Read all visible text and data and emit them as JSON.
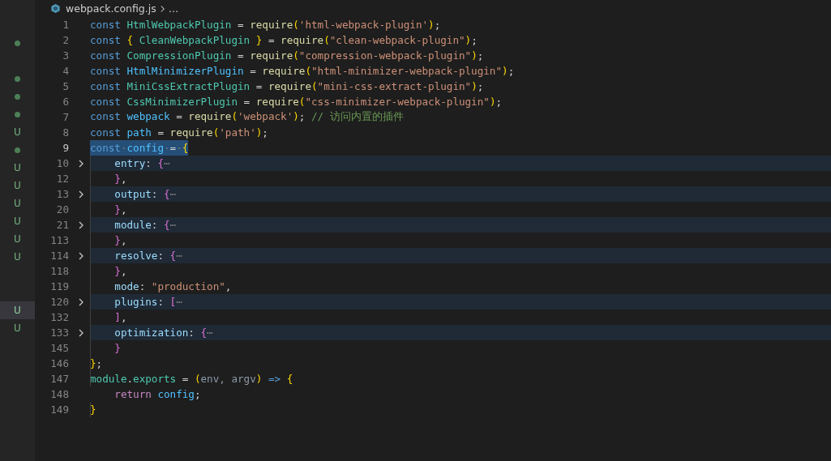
{
  "side_markers": [
    {
      "kind": "empty",
      "selected": false
    },
    {
      "kind": "dot",
      "selected": false
    },
    {
      "kind": "empty",
      "selected": false
    },
    {
      "kind": "dot",
      "selected": false
    },
    {
      "kind": "dot",
      "selected": false
    },
    {
      "kind": "dot",
      "selected": false
    },
    {
      "kind": "letter",
      "text": "U",
      "selected": false
    },
    {
      "kind": "dot",
      "selected": false
    },
    {
      "kind": "letter",
      "text": "U",
      "selected": false
    },
    {
      "kind": "letter",
      "text": "U",
      "selected": false
    },
    {
      "kind": "letter",
      "text": "U",
      "selected": false
    },
    {
      "kind": "letter",
      "text": "U",
      "selected": false
    },
    {
      "kind": "letter",
      "text": "U",
      "selected": false
    },
    {
      "kind": "letter",
      "text": "U",
      "selected": false
    },
    {
      "kind": "empty",
      "selected": false
    },
    {
      "kind": "empty",
      "selected": false
    },
    {
      "kind": "letter",
      "text": "U",
      "selected": true
    },
    {
      "kind": "letter",
      "text": "U",
      "selected": false
    }
  ],
  "breadcrumb": {
    "file": "webpack.config.js",
    "more": "…"
  },
  "lines": [
    {
      "number": "1",
      "folded": false,
      "current": false,
      "tokens": [
        {
          "t": "const ",
          "kind": "kw"
        },
        {
          "t": "HtmlWebpackPlugin",
          "kind": "cls"
        },
        {
          "t": " = ",
          "kind": "p"
        },
        {
          "t": "require",
          "kind": "fn"
        },
        {
          "t": "(",
          "kind": "b1"
        },
        {
          "t": "'html-webpack-plugin'",
          "kind": "str"
        },
        {
          "t": ")",
          "kind": "b1"
        },
        {
          "t": ";",
          "kind": "p"
        }
      ]
    },
    {
      "number": "2",
      "folded": false,
      "current": false,
      "tokens": [
        {
          "t": "const ",
          "kind": "kw"
        },
        {
          "t": "{",
          "kind": "b1"
        },
        {
          "t": " CleanWebpackPlugin ",
          "kind": "cls"
        },
        {
          "t": "}",
          "kind": "b1"
        },
        {
          "t": " = ",
          "kind": "p"
        },
        {
          "t": "require",
          "kind": "fn"
        },
        {
          "t": "(",
          "kind": "b1"
        },
        {
          "t": "\"clean-webpack-plugin\"",
          "kind": "str"
        },
        {
          "t": ")",
          "kind": "b1"
        },
        {
          "t": ";",
          "kind": "p"
        }
      ]
    },
    {
      "number": "3",
      "folded": false,
      "current": false,
      "tokens": [
        {
          "t": "const ",
          "kind": "kw"
        },
        {
          "t": "CompressionPlugin",
          "kind": "cls"
        },
        {
          "t": " = ",
          "kind": "p"
        },
        {
          "t": "require",
          "kind": "fn"
        },
        {
          "t": "(",
          "kind": "b1"
        },
        {
          "t": "\"compression-webpack-plugin\"",
          "kind": "str"
        },
        {
          "t": ")",
          "kind": "b1"
        },
        {
          "t": ";",
          "kind": "p"
        }
      ]
    },
    {
      "number": "4",
      "folded": false,
      "current": false,
      "tokens": [
        {
          "t": "const ",
          "kind": "kw"
        },
        {
          "t": "HtmlMinimizerPlugin",
          "kind": "var"
        },
        {
          "t": " = ",
          "kind": "p"
        },
        {
          "t": "require",
          "kind": "fn"
        },
        {
          "t": "(",
          "kind": "b1"
        },
        {
          "t": "\"html-minimizer-webpack-plugin\"",
          "kind": "str"
        },
        {
          "t": ")",
          "kind": "b1"
        },
        {
          "t": ";",
          "kind": "p"
        }
      ]
    },
    {
      "number": "5",
      "folded": false,
      "current": false,
      "tokens": [
        {
          "t": "const ",
          "kind": "kw"
        },
        {
          "t": "MiniCssExtractPlugin",
          "kind": "cls"
        },
        {
          "t": " = ",
          "kind": "p"
        },
        {
          "t": "require",
          "kind": "fn"
        },
        {
          "t": "(",
          "kind": "b1"
        },
        {
          "t": "\"mini-css-extract-plugin\"",
          "kind": "str"
        },
        {
          "t": ")",
          "kind": "b1"
        },
        {
          "t": ";",
          "kind": "p"
        }
      ]
    },
    {
      "number": "6",
      "folded": false,
      "current": false,
      "tokens": [
        {
          "t": "const ",
          "kind": "kw"
        },
        {
          "t": "CssMinimizerPlugin",
          "kind": "cls"
        },
        {
          "t": " = ",
          "kind": "p"
        },
        {
          "t": "require",
          "kind": "fn"
        },
        {
          "t": "(",
          "kind": "b1"
        },
        {
          "t": "\"css-minimizer-webpack-plugin\"",
          "kind": "str"
        },
        {
          "t": ")",
          "kind": "b1"
        },
        {
          "t": ";",
          "kind": "p"
        }
      ]
    },
    {
      "number": "7",
      "folded": false,
      "current": false,
      "tokens": [
        {
          "t": "const ",
          "kind": "kw"
        },
        {
          "t": "webpack",
          "kind": "const"
        },
        {
          "t": " = ",
          "kind": "p"
        },
        {
          "t": "require",
          "kind": "fn"
        },
        {
          "t": "(",
          "kind": "b1"
        },
        {
          "t": "'webpack'",
          "kind": "str"
        },
        {
          "t": ")",
          "kind": "b1"
        },
        {
          "t": "; ",
          "kind": "p"
        },
        {
          "t": "// 访问内置的插件",
          "kind": "cmt"
        }
      ]
    },
    {
      "number": "8",
      "folded": false,
      "current": false,
      "tokens": [
        {
          "t": "const ",
          "kind": "kw"
        },
        {
          "t": "path",
          "kind": "const"
        },
        {
          "t": " = ",
          "kind": "p"
        },
        {
          "t": "require",
          "kind": "fn"
        },
        {
          "t": "(",
          "kind": "b1"
        },
        {
          "t": "'path'",
          "kind": "str"
        },
        {
          "t": ")",
          "kind": "b1"
        },
        {
          "t": ";",
          "kind": "p"
        }
      ]
    },
    {
      "number": "9",
      "folded": false,
      "current": true,
      "tokens": [
        {
          "t": "const",
          "kind": "kw"
        },
        {
          "t": "·",
          "kind": "ws"
        },
        {
          "t": "config",
          "kind": "const"
        },
        {
          "t": "·",
          "kind": "ws"
        },
        {
          "t": "=",
          "kind": "p"
        },
        {
          "t": "·",
          "kind": "ws"
        },
        {
          "t": "{",
          "kind": "b1"
        }
      ]
    },
    {
      "number": "10",
      "folded": true,
      "current": false,
      "tokens": [
        {
          "t": "    entry",
          "kind": "prop"
        },
        {
          "t": ": ",
          "kind": "p"
        },
        {
          "t": "{",
          "kind": "b2"
        },
        {
          "t": "⋯",
          "kind": "ws"
        }
      ]
    },
    {
      "number": "12",
      "folded": false,
      "current": false,
      "tokens": [
        {
          "t": "    }",
          "kind": "b2"
        },
        {
          "t": ",",
          "kind": "p"
        }
      ]
    },
    {
      "number": "13",
      "folded": true,
      "current": false,
      "tokens": [
        {
          "t": "    output",
          "kind": "prop"
        },
        {
          "t": ": ",
          "kind": "p"
        },
        {
          "t": "{",
          "kind": "b2"
        },
        {
          "t": "⋯",
          "kind": "ws"
        }
      ]
    },
    {
      "number": "20",
      "folded": false,
      "current": false,
      "tokens": [
        {
          "t": "    }",
          "kind": "b2"
        },
        {
          "t": ",",
          "kind": "p"
        }
      ]
    },
    {
      "number": "21",
      "folded": true,
      "current": false,
      "tokens": [
        {
          "t": "    module",
          "kind": "prop"
        },
        {
          "t": ": ",
          "kind": "p"
        },
        {
          "t": "{",
          "kind": "b2"
        },
        {
          "t": "⋯",
          "kind": "ws"
        }
      ]
    },
    {
      "number": "113",
      "folded": false,
      "current": false,
      "tokens": [
        {
          "t": "    }",
          "kind": "b2"
        },
        {
          "t": ",",
          "kind": "p"
        }
      ]
    },
    {
      "number": "114",
      "folded": true,
      "current": false,
      "tokens": [
        {
          "t": "    resolve",
          "kind": "prop"
        },
        {
          "t": ": ",
          "kind": "p"
        },
        {
          "t": "{",
          "kind": "b2"
        },
        {
          "t": "⋯",
          "kind": "ws"
        }
      ]
    },
    {
      "number": "118",
      "folded": false,
      "current": false,
      "tokens": [
        {
          "t": "    }",
          "kind": "b2"
        },
        {
          "t": ",",
          "kind": "p"
        }
      ]
    },
    {
      "number": "119",
      "folded": false,
      "current": false,
      "tokens": [
        {
          "t": "    mode",
          "kind": "prop"
        },
        {
          "t": ": ",
          "kind": "p"
        },
        {
          "t": "\"production\"",
          "kind": "str"
        },
        {
          "t": ",",
          "kind": "p"
        }
      ]
    },
    {
      "number": "120",
      "folded": true,
      "current": false,
      "tokens": [
        {
          "t": "    plugins",
          "kind": "prop"
        },
        {
          "t": ": ",
          "kind": "p"
        },
        {
          "t": "[",
          "kind": "b2"
        },
        {
          "t": "⋯",
          "kind": "ws"
        }
      ]
    },
    {
      "number": "132",
      "folded": false,
      "current": false,
      "tokens": [
        {
          "t": "    ]",
          "kind": "b2"
        },
        {
          "t": ",",
          "kind": "p"
        }
      ]
    },
    {
      "number": "133",
      "folded": true,
      "current": false,
      "tokens": [
        {
          "t": "    optimization",
          "kind": "prop"
        },
        {
          "t": ": ",
          "kind": "p"
        },
        {
          "t": "{",
          "kind": "b2"
        },
        {
          "t": "⋯",
          "kind": "ws"
        }
      ]
    },
    {
      "number": "145",
      "folded": false,
      "current": false,
      "tokens": [
        {
          "t": "    }",
          "kind": "b2"
        }
      ]
    },
    {
      "number": "146",
      "folded": false,
      "current": false,
      "tokens": [
        {
          "t": "}",
          "kind": "b1"
        },
        {
          "t": ";",
          "kind": "p"
        }
      ]
    },
    {
      "number": "147",
      "folded": false,
      "current": false,
      "tokens": [
        {
          "t": "module",
          "kind": "cls"
        },
        {
          "t": ".",
          "kind": "p"
        },
        {
          "t": "exports",
          "kind": "cls"
        },
        {
          "t": " = ",
          "kind": "p"
        },
        {
          "t": "(",
          "kind": "b1"
        },
        {
          "t": "env, argv",
          "kind": "dim"
        },
        {
          "t": ")",
          "kind": "b1"
        },
        {
          "t": " => ",
          "kind": "kw"
        },
        {
          "t": "{",
          "kind": "b1"
        }
      ]
    },
    {
      "number": "148",
      "folded": false,
      "current": false,
      "tokens": [
        {
          "t": "    return ",
          "kind": "ctl"
        },
        {
          "t": "config",
          "kind": "const"
        },
        {
          "t": ";",
          "kind": "p"
        }
      ]
    },
    {
      "number": "149",
      "folded": false,
      "current": false,
      "tokens": [
        {
          "t": "}",
          "kind": "b1"
        }
      ]
    }
  ]
}
